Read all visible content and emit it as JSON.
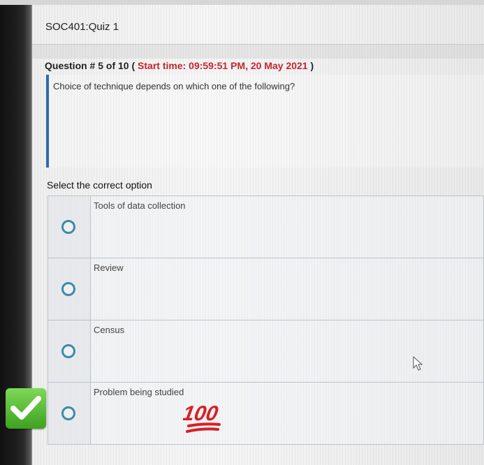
{
  "quiz": {
    "title": "SOC401:Quiz 1"
  },
  "question": {
    "prefix": "Question # 5 of 10 ( ",
    "time_label": "Start time: 09:59:51 PM, 20 May 2021",
    "suffix": " )",
    "text": "Choice of technique depends on which one of the following?"
  },
  "select_label": "Select the correct option",
  "options": [
    {
      "label": "Tools of data collection"
    },
    {
      "label": "Review"
    },
    {
      "label": "Census"
    },
    {
      "label": "Problem being studied"
    }
  ],
  "overlays": {
    "check_icon": "green-check-emoji",
    "hundred_icon": "hundred-points-emoji",
    "hundred_text": "100"
  },
  "colors": {
    "time": "#c4262e",
    "accent_bar": "#2f6aa8",
    "radio": "#3e8aa6",
    "check_green": "#4caf2a"
  }
}
